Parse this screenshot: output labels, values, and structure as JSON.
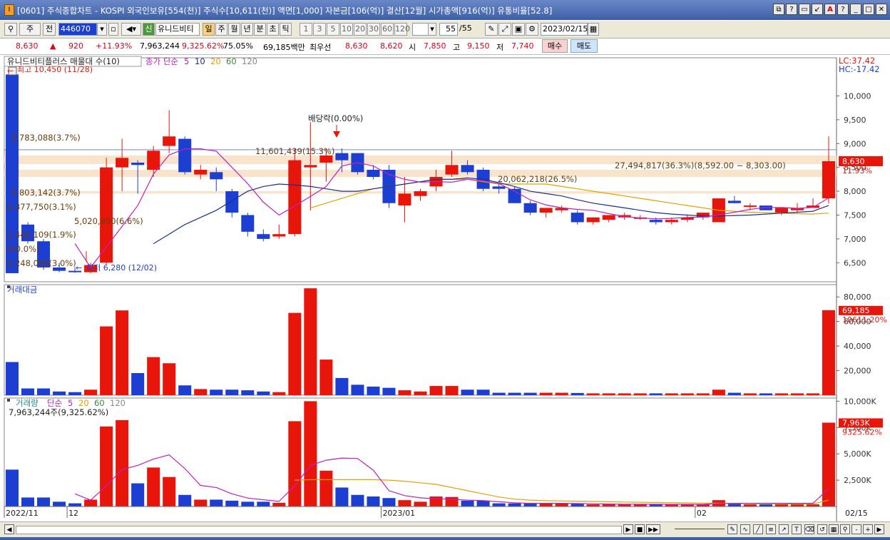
{
  "window": {
    "title": "[0601] 주식종합차트 - KOSPI 외국인보유[554(천)] 주식수[10,611(천)] 액면[1,000] 자본금[106(억)] 결산[12월] 시가총액[916(억)] 유통비율[52.8]",
    "app_icon": "I",
    "buttons": [
      "⧉",
      "?",
      "▭",
      "↙",
      "A",
      "?",
      "_",
      "□",
      "✕"
    ]
  },
  "toolbar": {
    "market_select": "주",
    "all_label": "전",
    "code": "446070",
    "stock_type_badge": "신",
    "stock_name": "유니드비티",
    "period_tabs": [
      "일",
      "주",
      "월",
      "년",
      "분",
      "초",
      "틱"
    ],
    "period_selected": "일",
    "interval_tabs": [
      "1",
      "3",
      "5",
      "10",
      "20",
      "30",
      "60",
      "120"
    ],
    "count": "55",
    "count_total": "/55",
    "date": "2023/02/15"
  },
  "quote": {
    "price": "8,630",
    "change": "920",
    "change_pct": "+11.93%",
    "volume": "7,963,244",
    "volume_ratio": "9,325.62%",
    "turnover": "75.05%",
    "amount": "69,185백만",
    "best_label": "최우선",
    "best_ask": "8,630",
    "best_bid": "8,620",
    "open_label": "시",
    "open": "7,850",
    "high_label": "고",
    "high": "9,150",
    "low_label": "저",
    "low": "7,740",
    "buy_label": "매수",
    "sell_label": "매도"
  },
  "colors": {
    "up": "#e8150b",
    "down": "#1c3fd2",
    "ma5": "#c020c0",
    "ma20": "#e8a000",
    "ma10": "#1c2f90",
    "band": "#f8e4cc",
    "bg": "#ffffff"
  },
  "chart_data": [
    {
      "type": "candlestick",
      "title": "유니드비티플러스 매물대 수(10)",
      "legend": {
        "label": "종가 단순",
        "items": [
          "5",
          "10",
          "20",
          "60",
          "120"
        ]
      },
      "top_right": {
        "lc": "LC:37.42",
        "hc": "HC:-17.42"
      },
      "y_ticks": [
        "10,000",
        "9,500",
        "9,000",
        "8,500",
        "8,000",
        "7,500",
        "7,000",
        "6,500"
      ],
      "y_tick_values": [
        10000,
        9500,
        9000,
        8500,
        8000,
        7500,
        7000,
        6500
      ],
      "ylim": [
        6100,
        10800
      ],
      "last_price_label": "8,630",
      "last_pct_label": "11.93%",
      "annotations": [
        {
          "text": "최고 10,450 (11/28)",
          "value": 10450
        },
        {
          "text": "최저 6,280 (12/02)",
          "value": 6280
        },
        {
          "text": "배당락(0.00%)"
        }
      ],
      "volume_profile": [
        {
          "label": "2,783,088(3.7%)"
        },
        {
          "label": "11,601,439(15.3%)"
        },
        {
          "label": "27,494,817(36.3%)(8,592.00 ~ 8,303.00)"
        },
        {
          "label": "20,062,218(26.5%)"
        },
        {
          "label": "2,803,142(3.7%)"
        },
        {
          "label": "2,377,750(3.1%)"
        },
        {
          "label": "5,020,950(6.6%)"
        },
        {
          "label": "1,440,109(1.9%)"
        },
        {
          "label": "0(0.0%)"
        },
        {
          "label": "2,248,089(3.0%)"
        }
      ],
      "ohlc": [
        [
          10450,
          10450,
          6280,
          6280
        ],
        [
          7300,
          7350,
          6900,
          6950
        ],
        [
          6950,
          7000,
          6350,
          6400
        ],
        [
          6400,
          6500,
          6300,
          6330
        ],
        [
          6330,
          6400,
          6290,
          6320
        ],
        [
          6300,
          6500,
          6280,
          6450
        ],
        [
          6500,
          8700,
          6450,
          8500
        ],
        [
          8500,
          9100,
          8000,
          8700
        ],
        [
          8600,
          8650,
          7950,
          8550
        ],
        [
          8450,
          8950,
          8300,
          8850
        ],
        [
          8950,
          9700,
          8800,
          9150
        ],
        [
          9100,
          9150,
          8350,
          8400
        ],
        [
          8350,
          8550,
          8250,
          8450
        ],
        [
          8400,
          8500,
          8000,
          8250
        ],
        [
          8000,
          8050,
          7450,
          7550
        ],
        [
          7500,
          7550,
          7050,
          7150
        ],
        [
          7100,
          7200,
          6950,
          7000
        ],
        [
          7050,
          7300,
          7000,
          7100
        ],
        [
          7100,
          8900,
          7050,
          8650
        ],
        [
          8500,
          9450,
          7600,
          8550
        ],
        [
          8600,
          8900,
          8200,
          8750
        ],
        [
          8800,
          8900,
          8400,
          8650
        ],
        [
          8800,
          8800,
          8350,
          8400
        ],
        [
          8450,
          8550,
          8250,
          8300
        ],
        [
          8450,
          8550,
          7650,
          7750
        ],
        [
          7700,
          8300,
          7350,
          7950
        ],
        [
          7900,
          8050,
          7800,
          8000
        ],
        [
          8100,
          8450,
          8000,
          8300
        ],
        [
          8350,
          8850,
          8300,
          8550
        ],
        [
          8550,
          8650,
          8350,
          8400
        ],
        [
          8450,
          8500,
          8000,
          8050
        ],
        [
          8100,
          8150,
          7950,
          8050
        ],
        [
          8050,
          8100,
          7750,
          7750
        ],
        [
          7750,
          7800,
          7500,
          7550
        ],
        [
          7550,
          7650,
          7450,
          7650
        ],
        [
          7600,
          7700,
          7550,
          7650
        ],
        [
          7550,
          7600,
          7300,
          7350
        ],
        [
          7350,
          7450,
          7300,
          7450
        ],
        [
          7400,
          7500,
          7350,
          7500
        ],
        [
          7450,
          7550,
          7400,
          7500
        ],
        [
          7450,
          7500,
          7400,
          7450
        ],
        [
          7400,
          7450,
          7300,
          7350
        ],
        [
          7350,
          7450,
          7300,
          7400
        ],
        [
          7400,
          7500,
          7350,
          7450
        ],
        [
          7450,
          7550,
          7400,
          7550
        ],
        [
          7350,
          7850,
          7350,
          7850
        ],
        [
          7800,
          7900,
          7750,
          7750
        ],
        [
          7700,
          7750,
          7600,
          7700
        ],
        [
          7700,
          7700,
          7600,
          7600
        ],
        [
          7550,
          7650,
          7500,
          7650
        ],
        [
          7600,
          7750,
          7550,
          7650
        ],
        [
          7650,
          7850,
          7650,
          7700
        ],
        [
          7850,
          9150,
          7740,
          8630
        ]
      ],
      "ma5": [
        null,
        null,
        null,
        null,
        6900,
        6400,
        6830,
        7260,
        7700,
        8360,
        8760,
        8890,
        8890,
        8840,
        8500,
        8160,
        7770,
        7500,
        7690,
        7890,
        8100,
        8530,
        8600,
        8530,
        8350,
        8250,
        8190,
        8200,
        8190,
        8250,
        8220,
        8160,
        8000,
        7820,
        7710,
        7650,
        7620,
        7600,
        7530,
        7470,
        7440,
        7420,
        7430,
        7450,
        7460,
        7500,
        7560,
        7620,
        7660,
        7660,
        7640,
        7660,
        7860
      ],
      "ma10": [
        null,
        null,
        null,
        null,
        null,
        null,
        null,
        null,
        null,
        6900,
        7100,
        7300,
        7450,
        7600,
        7800,
        8000,
        8100,
        8150,
        8130,
        8100,
        8050,
        8000,
        8000,
        8050,
        8100,
        8150,
        8200,
        8250,
        8250,
        8280,
        8250,
        8180,
        8100,
        8000,
        7950,
        7900,
        7820,
        7750,
        7700,
        7650,
        7600,
        7550,
        7520,
        7500,
        7480,
        7480,
        7490,
        7500,
        7520,
        7540,
        7560,
        7580,
        7700
      ],
      "ma20": [
        null,
        null,
        null,
        null,
        null,
        null,
        null,
        null,
        null,
        null,
        null,
        null,
        null,
        null,
        null,
        null,
        null,
        null,
        null,
        7650,
        7750,
        7850,
        7950,
        8050,
        8100,
        8150,
        8200,
        8250,
        8250,
        8250,
        8200,
        8150,
        8150,
        8150,
        8150,
        8100,
        8050,
        8000,
        7950,
        7900,
        7850,
        7800,
        7750,
        7700,
        7650,
        7600,
        7580,
        7560,
        7550,
        7540,
        7530,
        7520,
        7540
      ]
    },
    {
      "type": "bar",
      "title": "거래대금",
      "y_ticks": [
        "80,000",
        "60,000",
        "40,000",
        "20,000"
      ],
      "y_tick_values": [
        80000,
        60000,
        40000,
        20000
      ],
      "ylim": [
        0,
        90000
      ],
      "last_label": "69,185",
      "sub_label": "10611.20%",
      "values": [
        27000,
        5500,
        5500,
        3000,
        2500,
        4500,
        56000,
        69000,
        18000,
        31000,
        26000,
        8000,
        5000,
        4500,
        4500,
        4000,
        3000,
        2500,
        67000,
        87000,
        29000,
        14000,
        8500,
        7000,
        6000,
        4000,
        3000,
        7500,
        7500,
        4500,
        4500,
        2000,
        2000,
        2000,
        2000,
        2000,
        1800,
        1500,
        1500,
        1500,
        1500,
        1500,
        1500,
        1500,
        1500,
        4500,
        2000,
        1500,
        1500,
        1500,
        1500,
        1500,
        69185
      ]
    },
    {
      "type": "bar",
      "title": "거래량",
      "legend": {
        "label": "단순",
        "items": [
          "5",
          "20",
          "60",
          "120"
        ]
      },
      "subtitle": "7,963,244주(9,325.62%)",
      "y_ticks": [
        "10,000K",
        "7,500K",
        "5,000K",
        "2,500K"
      ],
      "y_tick_values": [
        10000,
        7500,
        5000,
        2500
      ],
      "ylim": [
        0,
        10300
      ],
      "last_label": "7,963K",
      "sub_label": "9325.62%",
      "values": [
        3500,
        850,
        850,
        450,
        300,
        650,
        7600,
        8200,
        2200,
        3700,
        2800,
        1100,
        650,
        650,
        550,
        450,
        450,
        350,
        8100,
        10000,
        3400,
        1800,
        1100,
        950,
        800,
        600,
        450,
        950,
        900,
        550,
        550,
        300,
        300,
        300,
        300,
        300,
        250,
        200,
        200,
        200,
        200,
        200,
        200,
        200,
        200,
        600,
        250,
        200,
        200,
        200,
        200,
        200,
        7963
      ],
      "ma5": [
        null,
        null,
        null,
        null,
        1200,
        600,
        1950,
        3500,
        3900,
        4500,
        4900,
        3600,
        2000,
        1800,
        1200,
        800,
        640,
        490,
        1960,
        3900,
        4400,
        4600,
        4560,
        3450,
        1500,
        1030,
        820,
        730,
        690,
        600,
        560,
        450,
        350,
        300,
        300,
        300,
        280,
        260,
        240,
        220,
        220,
        210,
        200,
        200,
        200,
        280,
        300,
        300,
        300,
        300,
        300,
        300,
        1700
      ],
      "ma20": [
        null,
        null,
        null,
        null,
        null,
        null,
        null,
        null,
        null,
        null,
        null,
        null,
        null,
        null,
        null,
        null,
        null,
        null,
        2500,
        2550,
        2550,
        2550,
        2550,
        2550,
        2500,
        2400,
        2250,
        2100,
        1800,
        1500,
        1200,
        900,
        700,
        600,
        550,
        530,
        500,
        480,
        450,
        420,
        400,
        380,
        360,
        340,
        320,
        310,
        290,
        270,
        260,
        250,
        240,
        240,
        600
      ]
    }
  ],
  "x_axis": {
    "labels": [
      "2022/11",
      "12",
      "2023/01",
      "02",
      "02/15"
    ]
  },
  "bottom_controls": [
    "▶",
    "■",
    "▶▶",
    "-",
    "+"
  ]
}
